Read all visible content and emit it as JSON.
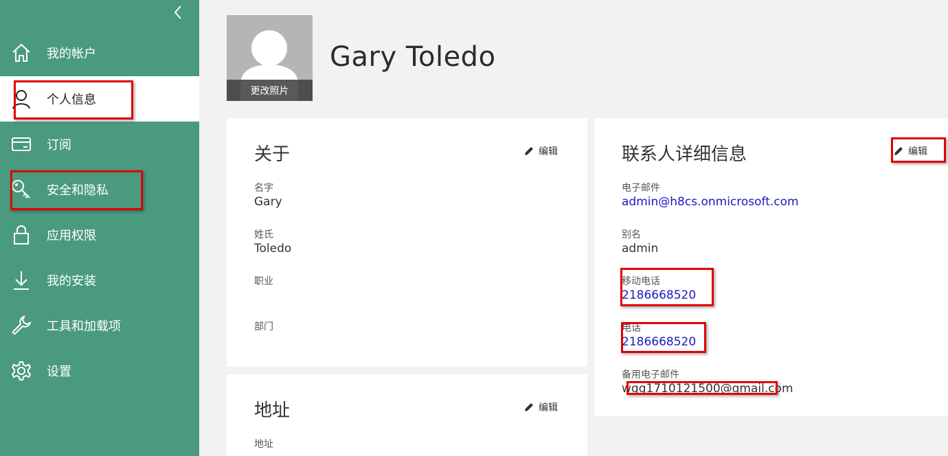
{
  "sidebar": {
    "items": [
      {
        "label": "我的帐户",
        "icon": "home-icon"
      },
      {
        "label": "个人信息",
        "icon": "person-icon"
      },
      {
        "label": "订阅",
        "icon": "card-icon"
      },
      {
        "label": "安全和隐私",
        "icon": "key-icon"
      },
      {
        "label": "应用权限",
        "icon": "lock-icon"
      },
      {
        "label": "我的安装",
        "icon": "download-icon"
      },
      {
        "label": "工具和加载项",
        "icon": "wrench-icon"
      },
      {
        "label": "设置",
        "icon": "gear-icon"
      }
    ],
    "active_index": 1,
    "background": "#4a9a80"
  },
  "profile": {
    "name": "Gary Toledo",
    "change_photo": "更改照片"
  },
  "about": {
    "title": "关于",
    "edit": "编辑",
    "first_name_label": "名字",
    "first_name": "Gary",
    "last_name_label": "姓氏",
    "last_name": "Toledo",
    "job_label": "职业",
    "job": "",
    "department_label": "部门",
    "department": ""
  },
  "address": {
    "title": "地址",
    "edit": "编辑",
    "address_label": "地址"
  },
  "contact": {
    "title": "联系人详细信息",
    "edit": "编辑",
    "email_label": "电子邮件",
    "email": "admin@h8cs.onmicrosoft.com",
    "alias_label": "别名",
    "alias": "admin",
    "mobile_label": "移动电话",
    "mobile": "2186668520",
    "phone_label": "电话",
    "phone": "2186668520",
    "alt_email_label": "备用电子邮件",
    "alt_email": "wgq1710121500@gmail.com"
  },
  "colors": {
    "highlight": "#e00000",
    "link": "#1a1ac0"
  }
}
